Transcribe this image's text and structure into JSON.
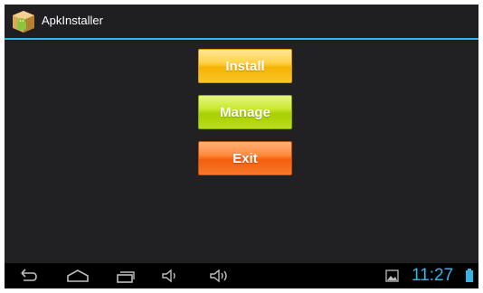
{
  "app": {
    "title": "ApkInstaller",
    "icon": "android-package-icon"
  },
  "buttons": {
    "install": "Install",
    "manage": "Manage",
    "exit": "Exit"
  },
  "status_bar": {
    "time": "11:27",
    "icons": [
      "back-icon",
      "home-icon",
      "recent-apps-icon",
      "volume-down-icon",
      "volume-up-icon",
      "gallery-icon",
      "battery-icon"
    ]
  },
  "colors": {
    "accent": "#33b5e5",
    "install": "#f6b200",
    "manage": "#a8cf00",
    "exit": "#f25f0e"
  }
}
